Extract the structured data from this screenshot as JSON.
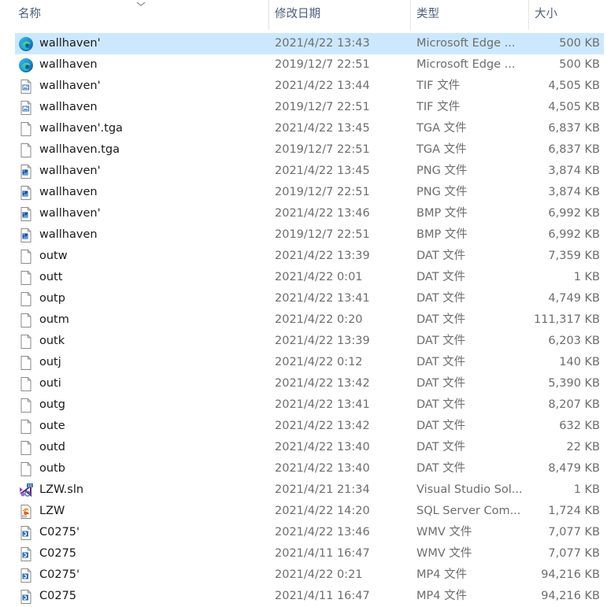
{
  "columns": {
    "name": "名称",
    "date": "修改日期",
    "type": "类型",
    "size": "大小"
  },
  "files": [
    {
      "name": "wallhaven'",
      "date": "2021/4/22 13:43",
      "type": "Microsoft Edge ...",
      "size": "500 KB",
      "icon": "edge-icon",
      "selected": true
    },
    {
      "name": "wallhaven",
      "date": "2019/12/7 22:51",
      "type": "Microsoft Edge ...",
      "size": "500 KB",
      "icon": "edge-icon"
    },
    {
      "name": "wallhaven'",
      "date": "2021/4/22 13:44",
      "type": "TIF 文件",
      "size": "4,505 KB",
      "icon": "tif-file-icon"
    },
    {
      "name": "wallhaven",
      "date": "2019/12/7 22:51",
      "type": "TIF 文件",
      "size": "4,505 KB",
      "icon": "tif-file-icon"
    },
    {
      "name": "wallhaven'.tga",
      "date": "2021/4/22 13:45",
      "type": "TGA 文件",
      "size": "6,837 KB",
      "icon": "blank-file-icon"
    },
    {
      "name": "wallhaven.tga",
      "date": "2019/12/7 22:51",
      "type": "TGA 文件",
      "size": "6,837 KB",
      "icon": "blank-file-icon"
    },
    {
      "name": "wallhaven'",
      "date": "2021/4/22 13:45",
      "type": "PNG 文件",
      "size": "3,874 KB",
      "icon": "image-file-icon"
    },
    {
      "name": "wallhaven",
      "date": "2019/12/7 22:51",
      "type": "PNG 文件",
      "size": "3,874 KB",
      "icon": "image-file-icon"
    },
    {
      "name": "wallhaven'",
      "date": "2021/4/22 13:46",
      "type": "BMP 文件",
      "size": "6,992 KB",
      "icon": "image-file-icon"
    },
    {
      "name": "wallhaven",
      "date": "2019/12/7 22:51",
      "type": "BMP 文件",
      "size": "6,992 KB",
      "icon": "image-file-icon"
    },
    {
      "name": "outw",
      "date": "2021/4/22 13:39",
      "type": "DAT 文件",
      "size": "7,359 KB",
      "icon": "blank-file-icon"
    },
    {
      "name": "outt",
      "date": "2021/4/22 0:01",
      "type": "DAT 文件",
      "size": "1 KB",
      "icon": "blank-file-icon"
    },
    {
      "name": "outp",
      "date": "2021/4/22 13:41",
      "type": "DAT 文件",
      "size": "4,749 KB",
      "icon": "blank-file-icon"
    },
    {
      "name": "outm",
      "date": "2021/4/22 0:20",
      "type": "DAT 文件",
      "size": "111,317 KB",
      "icon": "blank-file-icon"
    },
    {
      "name": "outk",
      "date": "2021/4/22 13:39",
      "type": "DAT 文件",
      "size": "6,203 KB",
      "icon": "blank-file-icon"
    },
    {
      "name": "outj",
      "date": "2021/4/22 0:12",
      "type": "DAT 文件",
      "size": "140 KB",
      "icon": "blank-file-icon"
    },
    {
      "name": "outi",
      "date": "2021/4/22 13:42",
      "type": "DAT 文件",
      "size": "5,390 KB",
      "icon": "blank-file-icon"
    },
    {
      "name": "outg",
      "date": "2021/4/22 13:41",
      "type": "DAT 文件",
      "size": "8,207 KB",
      "icon": "blank-file-icon"
    },
    {
      "name": "oute",
      "date": "2021/4/22 13:42",
      "type": "DAT 文件",
      "size": "632 KB",
      "icon": "blank-file-icon"
    },
    {
      "name": "outd",
      "date": "2021/4/22 13:40",
      "type": "DAT 文件",
      "size": "22 KB",
      "icon": "blank-file-icon"
    },
    {
      "name": "outb",
      "date": "2021/4/22 13:40",
      "type": "DAT 文件",
      "size": "8,479 KB",
      "icon": "blank-file-icon"
    },
    {
      "name": "LZW.sln",
      "date": "2021/4/21 21:34",
      "type": "Visual Studio Sol...",
      "size": "1 KB",
      "icon": "visual-studio-icon"
    },
    {
      "name": "LZW",
      "date": "2021/4/22 14:20",
      "type": "SQL Server Com...",
      "size": "1,724 KB",
      "icon": "sql-server-icon"
    },
    {
      "name": "C0275'",
      "date": "2021/4/22 13:46",
      "type": "WMV 文件",
      "size": "7,077 KB",
      "icon": "video-file-icon"
    },
    {
      "name": "C0275",
      "date": "2021/4/11 16:47",
      "type": "WMV 文件",
      "size": "7,077 KB",
      "icon": "video-file-icon"
    },
    {
      "name": "C0275'",
      "date": "2021/4/22 0:21",
      "type": "MP4 文件",
      "size": "94,216 KB",
      "icon": "video-file-icon"
    },
    {
      "name": "C0275",
      "date": "2021/4/11 16:47",
      "type": "MP4 文件",
      "size": "94,216 KB",
      "icon": "video-file-icon"
    }
  ],
  "colors": {
    "selection": "#cce8ff",
    "header_text": "#4c607a",
    "secondary_text": "#6d6d6d"
  }
}
